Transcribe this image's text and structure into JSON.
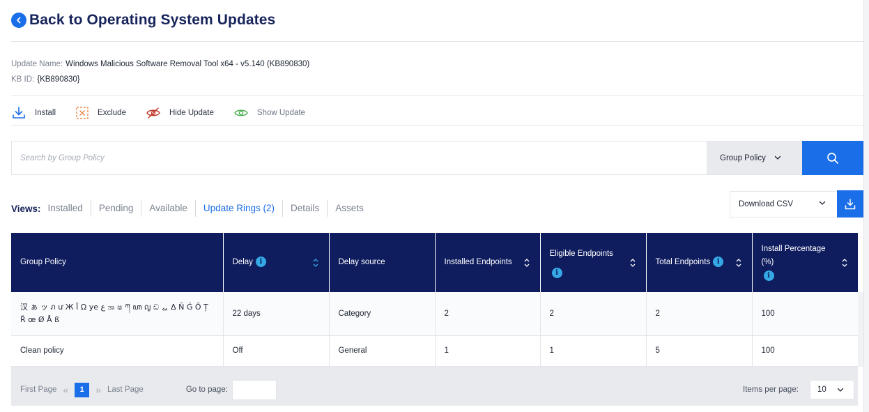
{
  "header": {
    "title": "Back to Operating System Updates"
  },
  "update": {
    "name_label": "Update Name:",
    "name_value": "Windows Malicious Software Removal Tool x64 - v5.140 (KB890830)",
    "kb_label": "KB ID:",
    "kb_value": "{KB890830}"
  },
  "actions": {
    "install": "Install",
    "exclude": "Exclude",
    "hide": "Hide Update",
    "show": "Show Update"
  },
  "search": {
    "placeholder": "Search by Group Policy",
    "filter_value": "Group Policy"
  },
  "views": {
    "label": "Views:",
    "tabs": [
      "Installed",
      "Pending",
      "Available",
      "Update Rings (2)",
      "Details",
      "Assets"
    ],
    "active": "Update Rings (2)"
  },
  "csv": {
    "label": "Download CSV"
  },
  "table": {
    "columns": [
      "Group Policy",
      "Delay",
      "Delay source",
      "Installed Endpoints",
      "Eligible Endpoints",
      "Total Endpoints",
      "Install Percentage (%)"
    ],
    "rows": [
      {
        "group_policy": "汉 ぁ ッ ภ ư Ж Ï Ω ye ع  အ ෂ ཀ ꦲ  ญ ඩ ᇱ Δ Ñ Ĝ Ő Ț Ř œ Ø Å ß",
        "delay": "22 days",
        "delay_source": "Category",
        "installed": "2",
        "eligible": "2",
        "total": "2",
        "percentage": "100"
      },
      {
        "group_policy": "Clean policy",
        "delay": "Off",
        "delay_source": "General",
        "installed": "1",
        "eligible": "1",
        "total": "5",
        "percentage": "100"
      }
    ]
  },
  "pagination": {
    "first": "First Page",
    "last": "Last Page",
    "current": "1",
    "goto_label": "Go to page:",
    "items_label": "Items per page:",
    "items_value": "10"
  },
  "colors": {
    "accent": "#1a6ee8",
    "header_navy": "#0f1d5f",
    "info_blue": "#35a9e6"
  }
}
